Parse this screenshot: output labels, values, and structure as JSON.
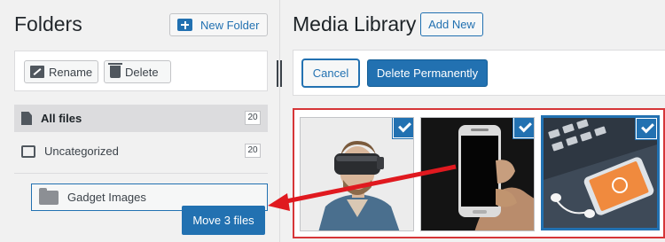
{
  "folders_panel": {
    "title": "Folders",
    "new_folder_label": "New Folder",
    "rename_label": "Rename",
    "delete_label": "Delete",
    "items": [
      {
        "label": "All files",
        "count": "20"
      },
      {
        "label": "Uncategorized",
        "count": "20"
      }
    ],
    "subfolders": [
      {
        "label": "Gadget Images"
      }
    ]
  },
  "drag_tooltip": "Move 3 files",
  "media_library": {
    "title": "Media Library",
    "add_new_label": "Add New",
    "cancel_label": "Cancel",
    "delete_permanently_label": "Delete Permanently",
    "items": [
      {
        "subject": "person-vr-headset",
        "selected": true
      },
      {
        "subject": "hand-holding-smartphone",
        "selected": true
      },
      {
        "subject": "phone-on-keyboard-earbuds",
        "selected": true
      }
    ]
  },
  "colors": {
    "accent": "#2271b1",
    "selection_frame": "#d63638",
    "arrow": "#e0191f"
  }
}
